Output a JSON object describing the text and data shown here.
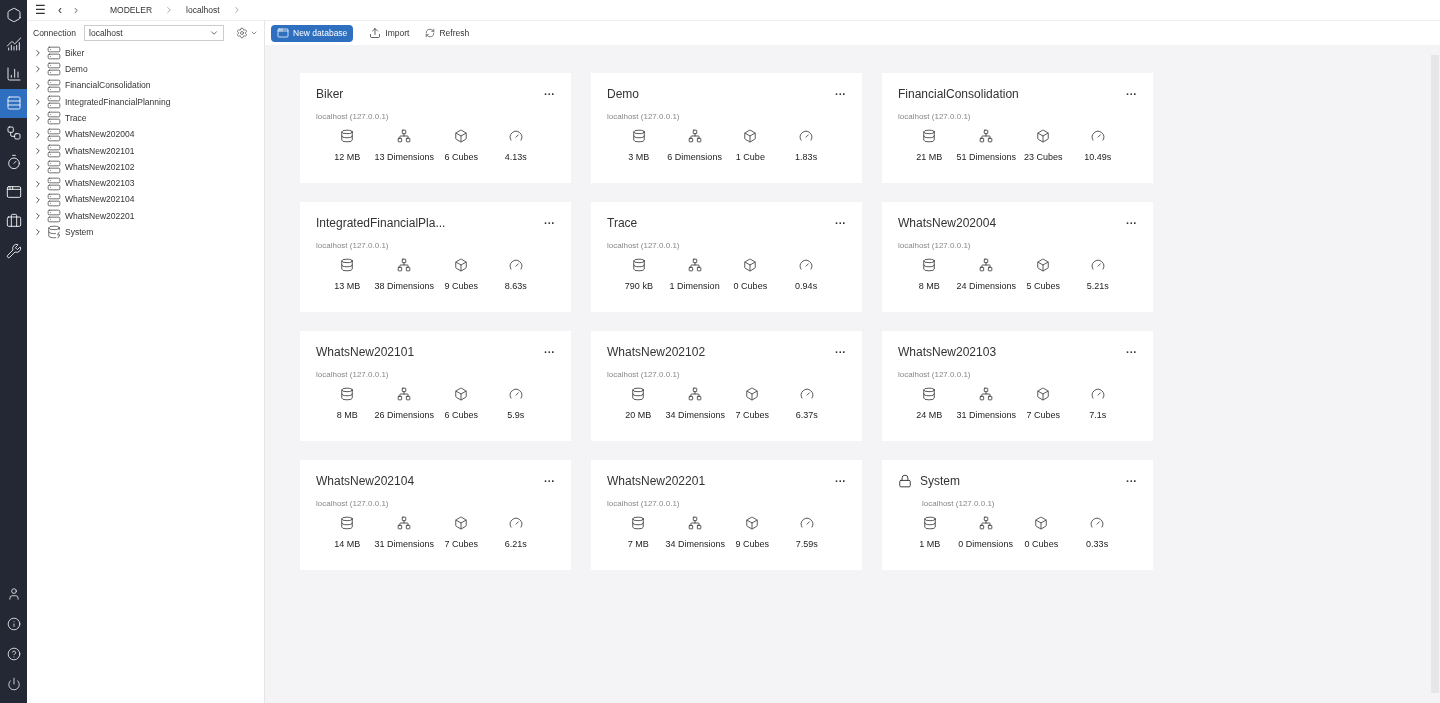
{
  "topbar": {
    "menu": "☰",
    "back": "‹",
    "forward": "›",
    "breadcrumb": [
      "MODELER",
      "localhost"
    ]
  },
  "connection": {
    "label": "Connection",
    "value": "localhost"
  },
  "tree": [
    {
      "label": "Biker",
      "kind": "database"
    },
    {
      "label": "Demo",
      "kind": "database"
    },
    {
      "label": "FinancialConsolidation",
      "kind": "database"
    },
    {
      "label": "IntegratedFinancialPlanning",
      "kind": "database"
    },
    {
      "label": "Trace",
      "kind": "database"
    },
    {
      "label": "WhatsNew202004",
      "kind": "database"
    },
    {
      "label": "WhatsNew202101",
      "kind": "database"
    },
    {
      "label": "WhatsNew202102",
      "kind": "database"
    },
    {
      "label": "WhatsNew202103",
      "kind": "database"
    },
    {
      "label": "WhatsNew202104",
      "kind": "database"
    },
    {
      "label": "WhatsNew202201",
      "kind": "database"
    },
    {
      "label": "System",
      "kind": "system"
    }
  ],
  "toolbar": {
    "new_database": "New database",
    "import": "Import",
    "refresh": "Refresh"
  },
  "cards": [
    {
      "name": "Biker",
      "host": "localhost (127.0.0.1)",
      "size": "12 MB",
      "dimensions": "13 Dimensions",
      "cubes": "6 Cubes",
      "time": "4.13s",
      "locked": false,
      "menu": "···"
    },
    {
      "name": "Demo",
      "host": "localhost (127.0.0.1)",
      "size": "3 MB",
      "dimensions": "6 Dimensions",
      "cubes": "1 Cube",
      "time": "1.83s",
      "locked": false,
      "menu": "···"
    },
    {
      "name": "FinancialConsolidation",
      "host": "localhost (127.0.0.1)",
      "size": "21 MB",
      "dimensions": "51 Dimensions",
      "cubes": "23 Cubes",
      "time": "10.49s",
      "locked": false,
      "menu": "···"
    },
    {
      "name": "IntegratedFinancialPla...",
      "host": "localhost (127.0.0.1)",
      "size": "13 MB",
      "dimensions": "38 Dimensions",
      "cubes": "9 Cubes",
      "time": "8.63s",
      "locked": false,
      "menu": "···"
    },
    {
      "name": "Trace",
      "host": "localhost (127.0.0.1)",
      "size": "790 kB",
      "dimensions": "1 Dimension",
      "cubes": "0 Cubes",
      "time": "0.94s",
      "locked": false,
      "menu": "···"
    },
    {
      "name": "WhatsNew202004",
      "host": "localhost (127.0.0.1)",
      "size": "8 MB",
      "dimensions": "24 Dimensions",
      "cubes": "5 Cubes",
      "time": "5.21s",
      "locked": false,
      "menu": "···"
    },
    {
      "name": "WhatsNew202101",
      "host": "localhost (127.0.0.1)",
      "size": "8 MB",
      "dimensions": "26 Dimensions",
      "cubes": "6 Cubes",
      "time": "5.9s",
      "locked": false,
      "menu": "···"
    },
    {
      "name": "WhatsNew202102",
      "host": "localhost (127.0.0.1)",
      "size": "20 MB",
      "dimensions": "34 Dimensions",
      "cubes": "7 Cubes",
      "time": "6.37s",
      "locked": false,
      "menu": "···"
    },
    {
      "name": "WhatsNew202103",
      "host": "localhost (127.0.0.1)",
      "size": "24 MB",
      "dimensions": "31 Dimensions",
      "cubes": "7 Cubes",
      "time": "7.1s",
      "locked": false,
      "menu": "···"
    },
    {
      "name": "WhatsNew202104",
      "host": "localhost (127.0.0.1)",
      "size": "14 MB",
      "dimensions": "31 Dimensions",
      "cubes": "7 Cubes",
      "time": "6.21s",
      "locked": false,
      "menu": "···"
    },
    {
      "name": "WhatsNew202201",
      "host": "localhost (127.0.0.1)",
      "size": "7 MB",
      "dimensions": "34 Dimensions",
      "cubes": "9 Cubes",
      "time": "7.59s",
      "locked": false,
      "menu": "···"
    },
    {
      "name": "System",
      "host": "localhost (127.0.0.1)",
      "size": "1 MB",
      "dimensions": "0 Dimensions",
      "cubes": "0 Cubes",
      "time": "0.33s",
      "locked": true,
      "menu": "···"
    }
  ]
}
